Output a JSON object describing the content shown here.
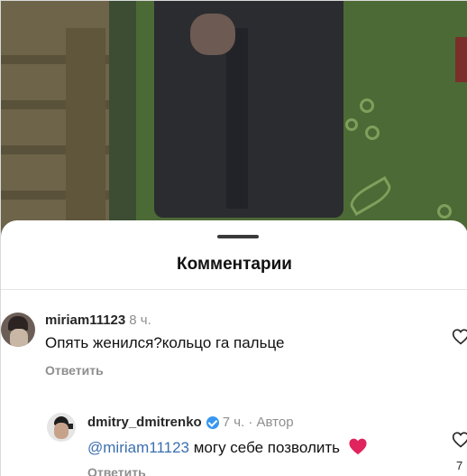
{
  "sheet": {
    "title": "Комментарии"
  },
  "comments": [
    {
      "username": "miriam11123",
      "time": "8 ч.",
      "text": "Опять женился?кольцо га пальце",
      "reply_label": "Ответить",
      "avatar_icon": "user-avatar"
    },
    {
      "username": "dmitry_dmitrenko",
      "verified": true,
      "time": "7 ч. · Автор",
      "mention": "@miriam11123",
      "text": "могу себе позволить",
      "emoji_icon": "red-heart-emoji",
      "reply_label": "Ответить",
      "like_count": "7",
      "avatar_icon": "author-avatar"
    }
  ],
  "colors": {
    "accent_link": "#3a6fb0",
    "verified_badge": "#3897f0",
    "muted_text": "#8e8e8e",
    "heart_emoji": "#e0245e"
  }
}
